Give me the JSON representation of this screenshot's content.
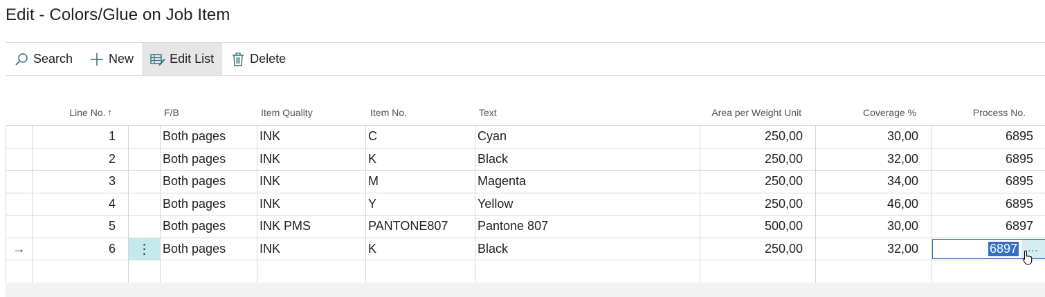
{
  "page": {
    "title": "Edit - Colors/Glue on Job Item"
  },
  "actions": [
    {
      "label": "Search",
      "icon": "search-icon"
    },
    {
      "label": "New",
      "icon": "plus-icon"
    },
    {
      "label": "Edit List",
      "icon": "edit-list-icon",
      "active": true
    },
    {
      "label": "Delete",
      "icon": "trash-icon"
    }
  ],
  "columns": {
    "line_no": "Line No.",
    "fb": "F/B",
    "item_quality": "Item Quality",
    "item_no": "Item No.",
    "text": "Text",
    "area": "Area per Weight Unit",
    "coverage": "Coverage %",
    "process_no": "Process No.",
    "sort_indicator": "↑"
  },
  "rows": [
    {
      "line_no": "1",
      "fb": "Both pages",
      "item_quality": "INK",
      "item_no": "C",
      "text": "Cyan",
      "area": "250,00",
      "coverage": "30,00",
      "process_no": "6895"
    },
    {
      "line_no": "2",
      "fb": "Both pages",
      "item_quality": "INK",
      "item_no": "K",
      "text": "Black",
      "area": "250,00",
      "coverage": "32,00",
      "process_no": "6895"
    },
    {
      "line_no": "3",
      "fb": "Both pages",
      "item_quality": "INK",
      "item_no": "M",
      "text": "Magenta",
      "area": "250,00",
      "coverage": "34,00",
      "process_no": "6895"
    },
    {
      "line_no": "4",
      "fb": "Both pages",
      "item_quality": "INK",
      "item_no": "Y",
      "text": "Yellow",
      "area": "250,00",
      "coverage": "46,00",
      "process_no": "6895"
    },
    {
      "line_no": "5",
      "fb": "Both pages",
      "item_quality": "INK PMS",
      "item_no": "PANTONE807",
      "text": "Pantone 807",
      "area": "500,00",
      "coverage": "30,00",
      "process_no": "6897"
    },
    {
      "line_no": "6",
      "fb": "Both pages",
      "item_quality": "INK",
      "item_no": "K",
      "text": "Black",
      "area": "250,00",
      "coverage": "32,00",
      "process_no": "6897"
    }
  ],
  "current_row": {
    "indicator": "→",
    "menu": "⋮",
    "lookup": "…"
  },
  "colors": {
    "accent": "#2a6bb5",
    "selection": "#3370c4",
    "menu_highlight": "#c4e9ec",
    "active_action": "#e6e6e6"
  }
}
